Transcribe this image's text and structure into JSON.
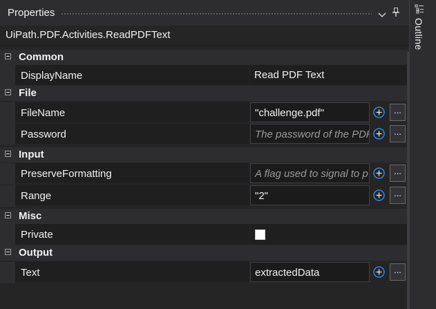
{
  "panel": {
    "title": "Properties",
    "activity_type": "UiPath.PDF.Activities.ReadPDFText"
  },
  "categories": {
    "common": {
      "label": "Common",
      "display_name": {
        "name": "DisplayName",
        "value": "Read PDF Text"
      }
    },
    "file": {
      "label": "File",
      "file_name": {
        "name": "FileName",
        "value": "\"challenge.pdf\""
      },
      "password": {
        "name": "Password",
        "placeholder": "The password of the PDF"
      }
    },
    "input": {
      "label": "Input",
      "preserve_formatting": {
        "name": "PreserveFormatting",
        "placeholder": "A flag used to signal to p"
      },
      "range": {
        "name": "Range",
        "value": "\"2\""
      }
    },
    "misc": {
      "label": "Misc",
      "private": {
        "name": "Private",
        "checked": false
      }
    },
    "output": {
      "label": "Output",
      "text": {
        "name": "Text",
        "value": "extractedData"
      }
    }
  },
  "buttons": {
    "more_label": "..."
  },
  "side_tab": {
    "label": "Outline"
  },
  "colors": {
    "accent_blue": "#3794ff",
    "background": "#252526"
  }
}
